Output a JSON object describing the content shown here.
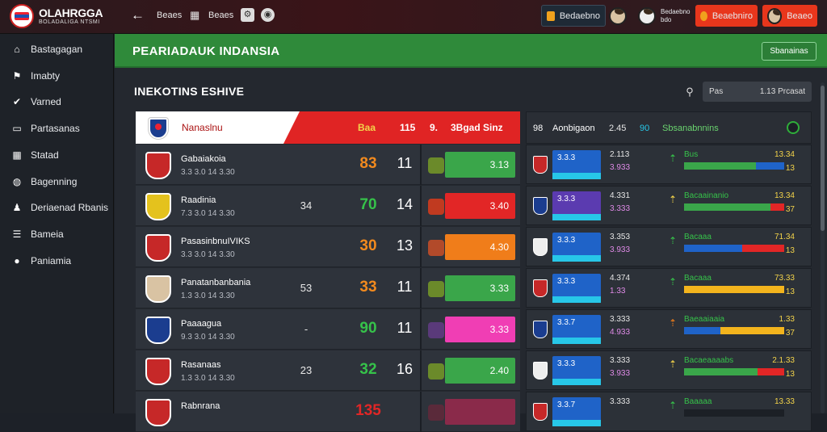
{
  "topbar": {
    "brand": "OLAHRGGA",
    "brand_sub": "BOLADALIGA NTSMI",
    "back_icon": "arrow-left-icon",
    "link1": "Beaes",
    "link2": "Beaes",
    "btn_alert": "Bedaebno",
    "user_label": "Bedaebno",
    "user_sub": "bdo",
    "btn_red1": "Beaebniro",
    "btn_red2": "Beaeo"
  },
  "sidebar": {
    "items": [
      {
        "label": "Bastagagan",
        "icon": "home-icon"
      },
      {
        "label": "Imabty",
        "icon": "flag-icon"
      },
      {
        "label": "Varned",
        "icon": "check-icon"
      },
      {
        "label": "Partasanas",
        "icon": "folder-icon"
      },
      {
        "label": "Statad",
        "icon": "grid-icon"
      },
      {
        "label": "Bagenning",
        "icon": "globe-icon"
      },
      {
        "label": "Deriaenad Rbanis",
        "icon": "users-icon"
      },
      {
        "label": "Bameia",
        "icon": "list-icon"
      },
      {
        "label": "Paniamia",
        "icon": "ball-icon"
      }
    ]
  },
  "banner": {
    "title": "PEARIADAUK INDANSIA",
    "button": "Sbanainas"
  },
  "section": {
    "title": "INEKOTINS ESHIVE",
    "search_left": "Pas",
    "search_right": "1.13 Prcasat"
  },
  "table": {
    "header": {
      "team_label": "Nanaslnu",
      "col1": "Baa",
      "col2": "115",
      "col3": "9.",
      "col4": "3Bgad Sinz"
    },
    "rows": [
      {
        "name": "Gabaiakoia",
        "sub": "3.3 3.0 14 3.30",
        "m1": "",
        "big": "83",
        "big_color": "#f28a1e",
        "n2": "11",
        "bar_value": "3.13",
        "bar_color": "#3aa64a",
        "mini_color": "#6b8a2a",
        "crest": "#c62828"
      },
      {
        "name": "Raadinia",
        "sub": "7.3 3.0 14 3.30",
        "m1": "34",
        "big": "70",
        "big_color": "#36c24a",
        "n2": "14",
        "bar_value": "3.40",
        "bar_color": "#e22626",
        "mini_color": "#c03a20",
        "crest": "#e4c21d"
      },
      {
        "name": "PasasinbnuIVIKS",
        "sub": "3.3 3.0 14 3.30",
        "m1": "",
        "big": "30",
        "big_color": "#f28a1e",
        "n2": "13",
        "bar_value": "4.30",
        "bar_color": "#f07d1a",
        "mini_color": "#b24a2a",
        "crest": "#c62828"
      },
      {
        "name": "Panatanbanbania",
        "sub": "1.3 3.0 14 3.30",
        "m1": "53",
        "big": "33",
        "big_color": "#f28a1e",
        "n2": "11",
        "bar_value": "3.33",
        "bar_color": "#3aa64a",
        "mini_color": "#6b8a2a",
        "crest": "#d9c3a3"
      },
      {
        "name": "Paaaagua",
        "sub": "9.3 3.0 14 3.30",
        "m1": "-",
        "big": "90",
        "big_color": "#36c24a",
        "n2": "11",
        "bar_value": "3.33",
        "bar_color": "#f03eb4",
        "mini_color": "#5a3a7a",
        "crest": "#1b3d8f"
      },
      {
        "name": "Rasanaas",
        "sub": "1.3 3.0 14 3.30",
        "m1": "23",
        "big": "32",
        "big_color": "#36c24a",
        "n2": "16",
        "bar_value": "2.40",
        "bar_color": "#3aa64a",
        "mini_color": "#6b8a2a",
        "crest": "#c62828"
      },
      {
        "name": "Rabnrana",
        "sub": "",
        "m1": "",
        "big": "135",
        "big_color": "#e22626",
        "n2": "",
        "bar_value": "",
        "bar_color": "#8a2a4a",
        "mini_color": "#5a2a3a",
        "crest": "#c62828"
      }
    ]
  },
  "right": {
    "header": {
      "a": "98",
      "b": "Aonbigaon",
      "c": "2.45",
      "d": "90",
      "e": "Sbsanabnnins"
    },
    "rows": [
      {
        "blk_label": "3.3.3",
        "blk": "#1f63c8",
        "v1": "2.113",
        "v2": "3.933",
        "dot": "#36c24a",
        "lab": "Bus",
        "lab_color": "#36c24a",
        "val": "13.34",
        "val2": "13",
        "g": 0.72,
        "b": 0.28,
        "r": 0
      },
      {
        "blk_label": "3.3.3",
        "blk": "#5b3bb0",
        "v1": "4.331",
        "v2": "3.333",
        "dot": "#f3d34a",
        "lab": "Bacaainanio",
        "lab_color": "#36c24a",
        "val": "13.34",
        "val2": "37",
        "g": 0.86,
        "b": 0,
        "r": 0.14
      },
      {
        "blk_label": "3.3.3",
        "blk": "#1f63c8",
        "v1": "3.353",
        "v2": "3.933",
        "dot": "#36c24a",
        "lab": "Bacaaa",
        "lab_color": "#36c24a",
        "val": "71.34",
        "val2": "13",
        "g": 0,
        "b": 0.58,
        "r": 0.42
      },
      {
        "blk_label": "3.3.3",
        "blk": "#1f63c8",
        "v1": "4.374",
        "v2": "1.33",
        "dot": "#36c24a",
        "lab": "Bacaaa",
        "lab_color": "#36c24a",
        "val": "73.33",
        "val2": "13",
        "g": 0,
        "b": 0,
        "r": 0,
        "y": 1
      },
      {
        "blk_label": "3.3.7",
        "blk": "#1f63c8",
        "v1": "3.333",
        "v2": "4.933",
        "dot": "#f07d1a",
        "lab": "Baeaaiaaia",
        "lab_color": "#36c24a",
        "val": "1.33",
        "val2": "37",
        "g": 0,
        "b": 0.36,
        "r": 0,
        "y": 0.64
      },
      {
        "blk_label": "3.3.3",
        "blk": "#1f63c8",
        "v1": "3.333",
        "v2": "3.933",
        "dot": "#f3d34a",
        "lab": "Bacaeaaaabs",
        "lab_color": "#36c24a",
        "val": "2.1.33",
        "val2": "13",
        "g": 0.73,
        "b": 0,
        "r": 0.27
      },
      {
        "blk_label": "3.3.7",
        "blk": "#1f63c8",
        "v1": "3.333",
        "v2": "",
        "dot": "#36c24a",
        "lab": "Baaaaa",
        "lab_color": "#36c24a",
        "val": "13.33",
        "val2": "",
        "g": 0,
        "b": 0,
        "r": 0
      }
    ]
  }
}
